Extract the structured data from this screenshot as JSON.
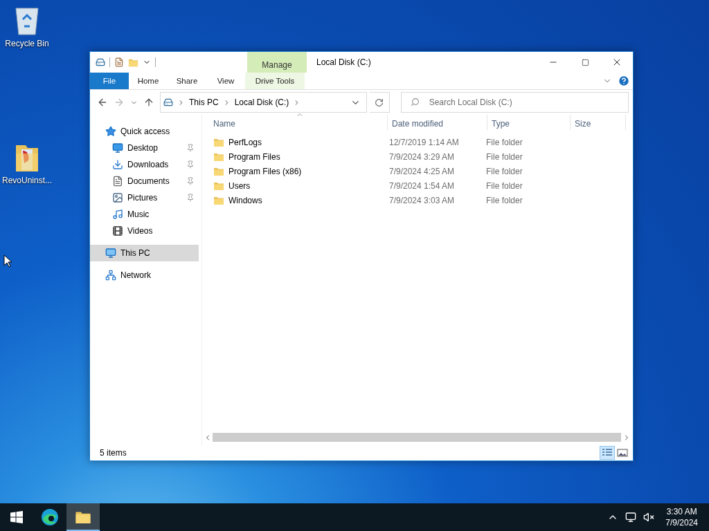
{
  "desktop": {
    "icons": [
      {
        "label": "Recycle Bin",
        "kind": "recycle"
      },
      {
        "label": "RevoUninst...",
        "kind": "folder"
      }
    ]
  },
  "window": {
    "title": "Local Disk (C:)",
    "context_group": "Manage",
    "ribbon_tabs": [
      {
        "label": "File",
        "kind": "file"
      },
      {
        "label": "Home",
        "kind": "normal"
      },
      {
        "label": "Share",
        "kind": "normal"
      },
      {
        "label": "View",
        "kind": "normal"
      },
      {
        "label": "Drive Tools",
        "kind": "contextual"
      }
    ],
    "address": {
      "crumbs": [
        "This PC",
        "Local Disk (C:)"
      ]
    },
    "search": {
      "placeholder": "Search Local Disk (C:)"
    },
    "navigation": [
      {
        "label": "Quick access",
        "kind": "star",
        "selected": false,
        "children": [
          {
            "label": "Desktop",
            "kind": "desktop",
            "pinned": true,
            "selected": false
          },
          {
            "label": "Downloads",
            "kind": "download",
            "pinned": true,
            "selected": false
          },
          {
            "label": "Documents",
            "kind": "document",
            "pinned": true,
            "selected": false
          },
          {
            "label": "Pictures",
            "kind": "picture",
            "pinned": true,
            "selected": false
          },
          {
            "label": "Music",
            "kind": "music",
            "pinned": false,
            "selected": false
          },
          {
            "label": "Videos",
            "kind": "video",
            "pinned": false,
            "selected": false
          }
        ]
      },
      {
        "label": "This PC",
        "kind": "pc",
        "selected": true
      },
      {
        "label": "Network",
        "kind": "network",
        "selected": false
      }
    ],
    "columns": [
      "Name",
      "Date modified",
      "Type",
      "Size"
    ],
    "rows": [
      {
        "name": "PerfLogs",
        "date": "12/7/2019 1:14 AM",
        "type": "File folder"
      },
      {
        "name": "Program Files",
        "date": "7/9/2024 3:29 AM",
        "type": "File folder"
      },
      {
        "name": "Program Files (x86)",
        "date": "7/9/2024 4:25 AM",
        "type": "File folder"
      },
      {
        "name": "Users",
        "date": "7/9/2024 1:54 AM",
        "type": "File folder"
      },
      {
        "name": "Windows",
        "date": "7/9/2024 3:03 AM",
        "type": "File folder"
      }
    ],
    "status": "5 items",
    "views": [
      {
        "kind": "details",
        "selected": true
      },
      {
        "kind": "tiles",
        "selected": false
      }
    ]
  },
  "taskbar": {
    "apps": [
      {
        "kind": "edge",
        "selected": false
      },
      {
        "kind": "explorer",
        "selected": true
      }
    ],
    "time": "3:30 AM",
    "date": "7/9/2024"
  }
}
